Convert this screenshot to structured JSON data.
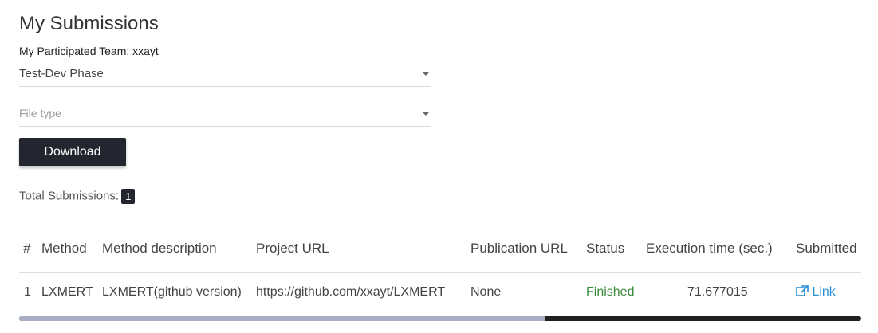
{
  "page": {
    "title": "My Submissions",
    "team_label": "My Participated Team: xxayt"
  },
  "filters": {
    "phase_value": "Test-Dev Phase",
    "file_type_placeholder": "File type"
  },
  "actions": {
    "download_label": "Download"
  },
  "summary": {
    "total_label": "Total Submissions:",
    "total_count": "1"
  },
  "table": {
    "headers": [
      "#",
      "Method",
      "Method description",
      "Project URL",
      "Publication URL",
      "Status",
      "Execution time (sec.)",
      "Submitted"
    ],
    "rows": [
      [
        "1",
        "LXMERT",
        "LXMERT(github version)",
        "https://github.com/xxayt/LXMERT",
        "None",
        "Finished",
        "71.677015",
        "Link"
      ]
    ]
  },
  "icons": {
    "external_link": "external-link-icon"
  },
  "colors": {
    "button_bg": "#24262f",
    "status_finished": "#3a8a3a",
    "link": "#2d8fd5"
  },
  "scroll": {
    "position_fraction": 0.0,
    "visible_fraction": 0.625
  }
}
